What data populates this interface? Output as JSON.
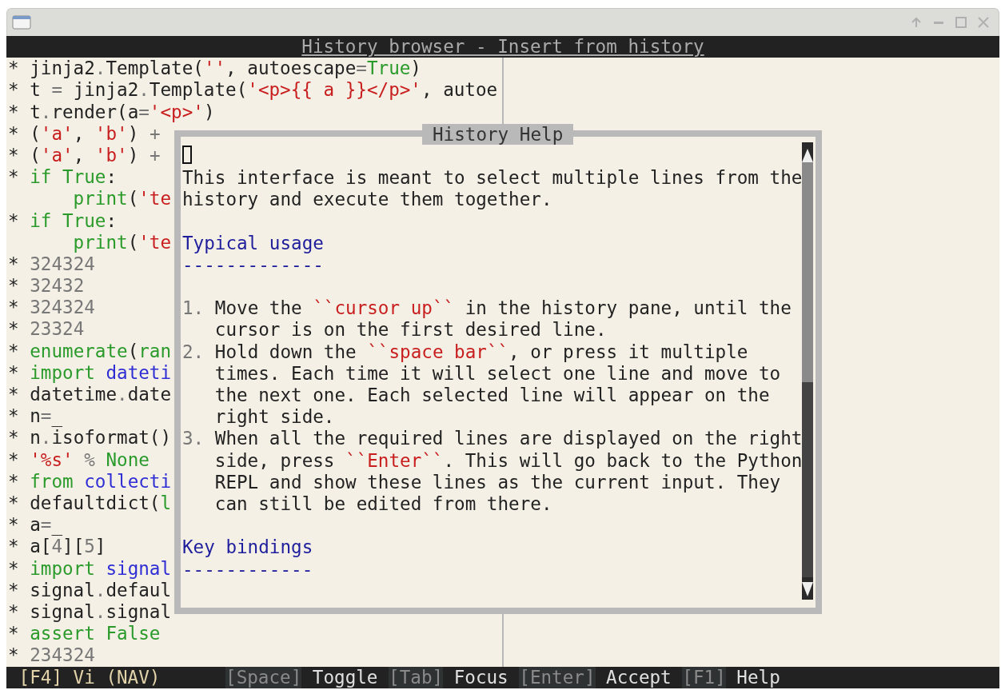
{
  "window": {
    "app_title": "History browser - Insert from history"
  },
  "history": {
    "lines": [
      {
        "tokens": [
          {
            "kind": "plain",
            "text": "* jinja2"
          },
          {
            "kind": "punct",
            "text": "."
          },
          {
            "kind": "plain",
            "text": "Template("
          },
          {
            "kind": "string",
            "text": "''"
          },
          {
            "kind": "plain",
            "text": ", autoescape"
          },
          {
            "kind": "punct",
            "text": "="
          },
          {
            "kind": "keyword",
            "text": "True"
          },
          {
            "kind": "plain",
            "text": ")"
          }
        ]
      },
      {
        "tokens": [
          {
            "kind": "plain",
            "text": "* t "
          },
          {
            "kind": "punct",
            "text": "="
          },
          {
            "kind": "plain",
            "text": " jinja2"
          },
          {
            "kind": "punct",
            "text": "."
          },
          {
            "kind": "plain",
            "text": "Template("
          },
          {
            "kind": "string",
            "text": "'<p>{{ a }}</p>'"
          },
          {
            "kind": "plain",
            "text": ", autoe"
          }
        ]
      },
      {
        "tokens": [
          {
            "kind": "plain",
            "text": "* t"
          },
          {
            "kind": "punct",
            "text": "."
          },
          {
            "kind": "plain",
            "text": "render(a"
          },
          {
            "kind": "punct",
            "text": "="
          },
          {
            "kind": "string",
            "text": "'<p>'"
          },
          {
            "kind": "plain",
            "text": ")"
          }
        ]
      },
      {
        "tokens": [
          {
            "kind": "plain",
            "text": "* ("
          },
          {
            "kind": "string",
            "text": "'a'"
          },
          {
            "kind": "plain",
            "text": ", "
          },
          {
            "kind": "string",
            "text": "'b'"
          },
          {
            "kind": "plain",
            "text": ") "
          },
          {
            "kind": "punct",
            "text": "+"
          }
        ]
      },
      {
        "tokens": [
          {
            "kind": "plain",
            "text": "* ("
          },
          {
            "kind": "string",
            "text": "'a'"
          },
          {
            "kind": "plain",
            "text": ", "
          },
          {
            "kind": "string",
            "text": "'b'"
          },
          {
            "kind": "plain",
            "text": ") "
          },
          {
            "kind": "punct",
            "text": "+"
          }
        ]
      },
      {
        "tokens": [
          {
            "kind": "plain",
            "text": "* "
          },
          {
            "kind": "keyword",
            "text": "if True"
          },
          {
            "kind": "plain",
            "text": ":"
          }
        ]
      },
      {
        "tokens": [
          {
            "kind": "keyword",
            "text": "      print"
          },
          {
            "kind": "plain",
            "text": "("
          },
          {
            "kind": "string",
            "text": "'te"
          }
        ]
      },
      {
        "tokens": [
          {
            "kind": "plain",
            "text": "* "
          },
          {
            "kind": "keyword",
            "text": "if True"
          },
          {
            "kind": "plain",
            "text": ":"
          }
        ]
      },
      {
        "tokens": [
          {
            "kind": "keyword",
            "text": "      print"
          },
          {
            "kind": "plain",
            "text": "("
          },
          {
            "kind": "string",
            "text": "'te"
          }
        ]
      },
      {
        "tokens": [
          {
            "kind": "plain",
            "text": "* "
          },
          {
            "kind": "punct",
            "text": "324324"
          }
        ]
      },
      {
        "tokens": [
          {
            "kind": "plain",
            "text": "* "
          },
          {
            "kind": "punct",
            "text": "32432"
          }
        ]
      },
      {
        "tokens": [
          {
            "kind": "plain",
            "text": "* "
          },
          {
            "kind": "punct",
            "text": "324324"
          }
        ]
      },
      {
        "tokens": [
          {
            "kind": "plain",
            "text": "* "
          },
          {
            "kind": "punct",
            "text": "23324"
          }
        ]
      },
      {
        "tokens": [
          {
            "kind": "plain",
            "text": "* "
          },
          {
            "kind": "keyword",
            "text": "enumerate"
          },
          {
            "kind": "plain",
            "text": "("
          },
          {
            "kind": "keyword",
            "text": "ran"
          }
        ]
      },
      {
        "tokens": [
          {
            "kind": "plain",
            "text": "* "
          },
          {
            "kind": "keyword",
            "text": "import "
          },
          {
            "kind": "name",
            "text": "dateti"
          }
        ]
      },
      {
        "tokens": [
          {
            "kind": "plain",
            "text": "* datetime"
          },
          {
            "kind": "punct",
            "text": "."
          },
          {
            "kind": "plain",
            "text": "date"
          }
        ]
      },
      {
        "tokens": [
          {
            "kind": "plain",
            "text": "* n"
          },
          {
            "kind": "punct",
            "text": "="
          },
          {
            "kind": "plain",
            "text": "_"
          }
        ]
      },
      {
        "tokens": [
          {
            "kind": "plain",
            "text": "* n"
          },
          {
            "kind": "punct",
            "text": "."
          },
          {
            "kind": "plain",
            "text": "isoformat()"
          }
        ]
      },
      {
        "tokens": [
          {
            "kind": "plain",
            "text": "* "
          },
          {
            "kind": "string",
            "text": "'%s' "
          },
          {
            "kind": "punct",
            "text": "% "
          },
          {
            "kind": "keyword",
            "text": "None"
          }
        ]
      },
      {
        "tokens": [
          {
            "kind": "plain",
            "text": "* "
          },
          {
            "kind": "keyword",
            "text": "from "
          },
          {
            "kind": "name",
            "text": "collecti"
          }
        ]
      },
      {
        "tokens": [
          {
            "kind": "plain",
            "text": "* defaultdict("
          },
          {
            "kind": "keyword",
            "text": "l"
          }
        ]
      },
      {
        "tokens": [
          {
            "kind": "plain",
            "text": "* a"
          },
          {
            "kind": "punct",
            "text": "="
          },
          {
            "kind": "plain",
            "text": "_"
          }
        ]
      },
      {
        "tokens": [
          {
            "kind": "plain",
            "text": "* a["
          },
          {
            "kind": "punct",
            "text": "4"
          },
          {
            "kind": "plain",
            "text": "]["
          },
          {
            "kind": "punct",
            "text": "5"
          },
          {
            "kind": "plain",
            "text": "]"
          }
        ]
      },
      {
        "tokens": [
          {
            "kind": "plain",
            "text": "* "
          },
          {
            "kind": "keyword",
            "text": "import "
          },
          {
            "kind": "name",
            "text": "signal"
          }
        ]
      },
      {
        "tokens": [
          {
            "kind": "plain",
            "text": "* signal"
          },
          {
            "kind": "punct",
            "text": "."
          },
          {
            "kind": "plain",
            "text": "defaul"
          }
        ]
      },
      {
        "tokens": [
          {
            "kind": "plain",
            "text": "* signal"
          },
          {
            "kind": "punct",
            "text": "."
          },
          {
            "kind": "plain",
            "text": "signal"
          }
        ]
      },
      {
        "tokens": [
          {
            "kind": "plain",
            "text": "* "
          },
          {
            "kind": "keyword",
            "text": "assert False"
          }
        ]
      },
      {
        "tokens": [
          {
            "kind": "plain",
            "text": "* "
          },
          {
            "kind": "punct",
            "text": "234324"
          }
        ]
      }
    ]
  },
  "help_dialog": {
    "title": "History Help",
    "lines": [
      {
        "kind": "cursor"
      },
      {
        "kind": "text",
        "segments": [
          {
            "kind": "plain",
            "text": "This interface is meant to select multiple lines from the"
          }
        ]
      },
      {
        "kind": "text",
        "segments": [
          {
            "kind": "plain",
            "text": "history and execute them together."
          }
        ]
      },
      {
        "kind": "blank"
      },
      {
        "kind": "text",
        "segments": [
          {
            "kind": "heading",
            "text": "Typical usage"
          }
        ]
      },
      {
        "kind": "text",
        "segments": [
          {
            "kind": "heading",
            "text": "-------------"
          }
        ]
      },
      {
        "kind": "blank"
      },
      {
        "kind": "text",
        "segments": [
          {
            "kind": "number",
            "text": "1."
          },
          {
            "kind": "plain",
            "text": " Move the "
          },
          {
            "kind": "literal",
            "text": "``cursor up``"
          },
          {
            "kind": "plain",
            "text": " in the history pane, until the"
          }
        ]
      },
      {
        "kind": "text",
        "segments": [
          {
            "kind": "plain",
            "text": "   cursor is on the first desired line."
          }
        ]
      },
      {
        "kind": "text",
        "segments": [
          {
            "kind": "number",
            "text": "2."
          },
          {
            "kind": "plain",
            "text": " Hold down the "
          },
          {
            "kind": "literal",
            "text": "``space bar``"
          },
          {
            "kind": "plain",
            "text": ", or press it multiple"
          }
        ]
      },
      {
        "kind": "text",
        "segments": [
          {
            "kind": "plain",
            "text": "   times. Each time it will select one line and move to"
          }
        ]
      },
      {
        "kind": "text",
        "segments": [
          {
            "kind": "plain",
            "text": "   the next one. Each selected line will appear on the"
          }
        ]
      },
      {
        "kind": "text",
        "segments": [
          {
            "kind": "plain",
            "text": "   right side."
          }
        ]
      },
      {
        "kind": "text",
        "segments": [
          {
            "kind": "number",
            "text": "3."
          },
          {
            "kind": "plain",
            "text": " When all the required lines are displayed on the right"
          }
        ]
      },
      {
        "kind": "text",
        "segments": [
          {
            "kind": "plain",
            "text": "   side, press "
          },
          {
            "kind": "literal",
            "text": "``Enter``"
          },
          {
            "kind": "plain",
            "text": ". This will go back to the Python"
          }
        ]
      },
      {
        "kind": "text",
        "segments": [
          {
            "kind": "plain",
            "text": "   REPL and show these lines as the current input. They"
          }
        ]
      },
      {
        "kind": "text",
        "segments": [
          {
            "kind": "plain",
            "text": "   can still be edited from there."
          }
        ]
      },
      {
        "kind": "blank"
      },
      {
        "kind": "text",
        "segments": [
          {
            "kind": "heading",
            "text": "Key bindings"
          }
        ]
      },
      {
        "kind": "text",
        "segments": [
          {
            "kind": "heading",
            "text": "------------"
          }
        ]
      },
      {
        "kind": "blank"
      }
    ]
  },
  "status_bar": {
    "mode": "[F4] Vi (NAV)",
    "hints": [
      {
        "key": "[Space]",
        "label": "Toggle"
      },
      {
        "key": "[Tab]",
        "label": "Focus"
      },
      {
        "key": "[Enter]",
        "label": "Accept"
      },
      {
        "key": "[F1]",
        "label": "Help"
      }
    ]
  }
}
